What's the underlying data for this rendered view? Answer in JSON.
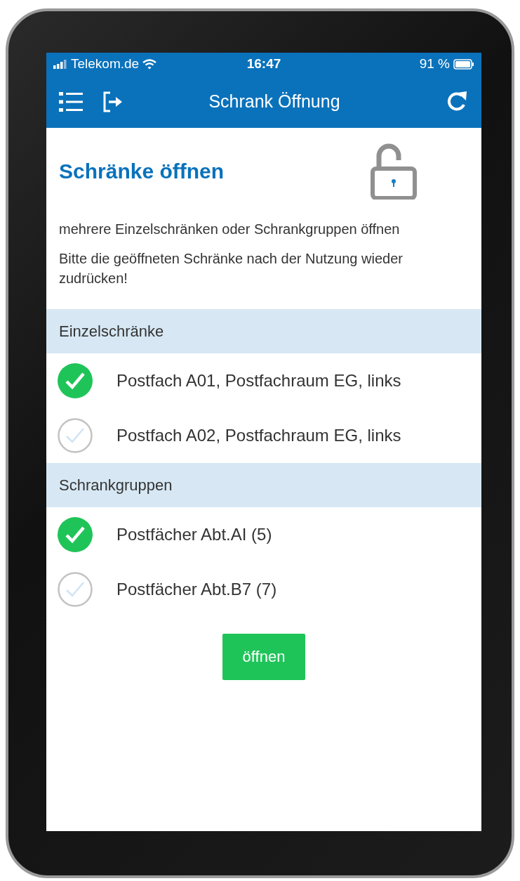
{
  "status_bar": {
    "carrier": "Telekom.de",
    "time": "16:47",
    "battery": "91 %"
  },
  "nav_bar": {
    "title": "Schrank Öffnung"
  },
  "heading": "Schränke öffnen",
  "paragraphs": [
    "mehrere Einzelschränken oder Schrankgruppen öffnen",
    "Bitte die geöffneten Schränke nach der Nutzung wieder zudrücken!"
  ],
  "sections": [
    {
      "title": "Einzelschränke",
      "items": [
        {
          "label": "Postfach A01, Postfachraum EG, links",
          "checked": true
        },
        {
          "label": "Postfach A02, Postfachraum EG, links",
          "checked": false
        }
      ]
    },
    {
      "title": "Schrankgruppen",
      "items": [
        {
          "label": "Postfächer Abt.AI (5)",
          "checked": true
        },
        {
          "label": "Postfächer Abt.B7 (7)",
          "checked": false
        }
      ]
    }
  ],
  "button": "öffnen"
}
